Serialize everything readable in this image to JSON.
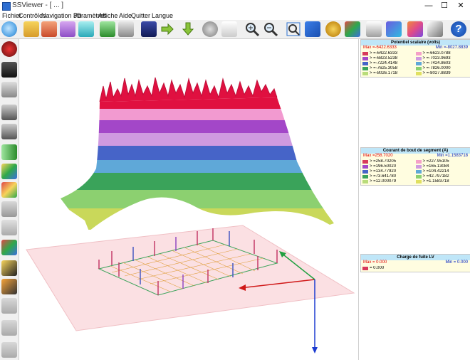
{
  "window": {
    "title": "SSViewer - [ ... ]",
    "minimize": "—",
    "maximize": "☐",
    "close": "✕"
  },
  "menu": [
    "Fichier",
    "Contrôles",
    "Navigation 3D",
    "Paramètres",
    "Affiche",
    "Aide",
    "Quitter",
    "Langue"
  ],
  "toolbar_icons": [
    "chat-icon",
    "open-file-icon",
    "folder-icon",
    "folder-icon",
    "folder-icon",
    "folder-icon",
    "layers-icon",
    "folder-icon",
    "3d-icon",
    "arrow-right-icon",
    "arrow-down-icon",
    "gears-icon",
    "hand-icon",
    "zoom-in-icon",
    "zoom-out-icon",
    "zoom-box-icon",
    "fit-icon",
    "orbit-icon",
    "rotate-icon",
    "print-icon",
    "palette-icon",
    "grid-icon",
    "brush-icon",
    "help-icon"
  ],
  "left_icons": [
    "render-icon",
    "binoculars-icon",
    "camera-icon",
    "camera-icon",
    "camera-add-icon",
    "cylinder-icon",
    "cube-icon",
    "cube-icon",
    "grid-icon",
    "grid-icon",
    "cubes-icon",
    "wireframe-icon",
    "lattice-icon",
    "shield-icon",
    "undo-icon",
    "undo-icon"
  ],
  "panel": {
    "block1": {
      "title": "Potentiel scalaire (volts)",
      "max": "Max =-6422.6333",
      "min": "Min =-8027.8839",
      "entries": [
        {
          "text": "> =-6422.6333",
          "color": "#d83a5b"
        },
        {
          "text": "> =-6623.0788",
          "color": "#f5a0c8"
        },
        {
          "text": "> =-6823.5238",
          "color": "#a347c8"
        },
        {
          "text": "> =-7023.9693",
          "color": "#cf9ae0"
        },
        {
          "text": "> =-7224.4148",
          "color": "#4664c8"
        },
        {
          "text": "> =-7424.8603",
          "color": "#5fa8d8"
        },
        {
          "text": "> =-7625.3058",
          "color": "#3aa35a"
        },
        {
          "text": "> =-7826.0000",
          "color": "#8cd070"
        },
        {
          "text": "> =-8026.1718",
          "color": "#b9dc7a"
        },
        {
          "text": "> =-8027.8839",
          "color": "#e0e060"
        }
      ]
    },
    "block2": {
      "title": "Courant de bout de segment (A)",
      "max": "Max =258.7020",
      "min": "Min =1.1583718",
      "entries": [
        {
          "text": "> =258.70205",
          "color": "#d83a5b"
        },
        {
          "text": "> =227.95105",
          "color": "#f5a0c8"
        },
        {
          "text": "> =196.50020",
          "color": "#a347c8"
        },
        {
          "text": "> =165.13084",
          "color": "#cf9ae0"
        },
        {
          "text": "> =134.77920",
          "color": "#4664c8"
        },
        {
          "text": "> =104.42214",
          "color": "#5fa8d8"
        },
        {
          "text": "> =73.641780",
          "color": "#3aa35a"
        },
        {
          "text": "> =42.797182",
          "color": "#8cd070"
        },
        {
          "text": "> =12.000079",
          "color": "#b9dc7a"
        },
        {
          "text": "> =1.1583718",
          "color": "#e0e060"
        }
      ]
    },
    "block3": {
      "title": "Charge de fuite LV",
      "max": "Max = 0.000",
      "min": "Min = 0.000",
      "entries": [
        {
          "text": "= 0.000",
          "color": "#d83a5b"
        }
      ]
    }
  }
}
